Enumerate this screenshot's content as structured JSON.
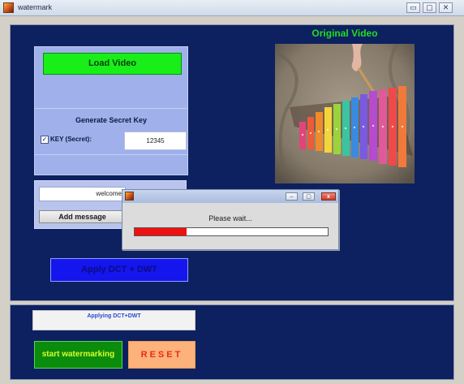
{
  "window": {
    "title": "watermark",
    "minimize_label": "▭",
    "maximize_label": "▢",
    "close_label": "✕"
  },
  "load_video": {
    "label": "Load Video"
  },
  "secret_key": {
    "heading": "Generate Secret Key",
    "checkbox_label": "KEY (Secret):",
    "checked": true,
    "checkbox_mark": "✓",
    "value": "12345"
  },
  "message": {
    "value": "welcome",
    "add_label": "Add message"
  },
  "apply_button": {
    "label": "Apply DCT + DWT"
  },
  "video": {
    "title": "Original Video"
  },
  "dialog": {
    "minimize_label": "–",
    "maximize_label": "▢",
    "close_label": "x",
    "message": "Please wait...",
    "progress": 0.27
  },
  "status": {
    "text": "Applying DCT+DWT"
  },
  "start_watermarking": {
    "label": "start watermarking"
  },
  "reset": {
    "label": "RESET"
  },
  "colors": {
    "panel_navy": "#0d2160",
    "load_green": "#19ee19",
    "video_title_green": "#22dd22",
    "apply_blue": "#1515ee",
    "progress_red": "#ee1111",
    "reset_orange": "#fcb27a"
  }
}
